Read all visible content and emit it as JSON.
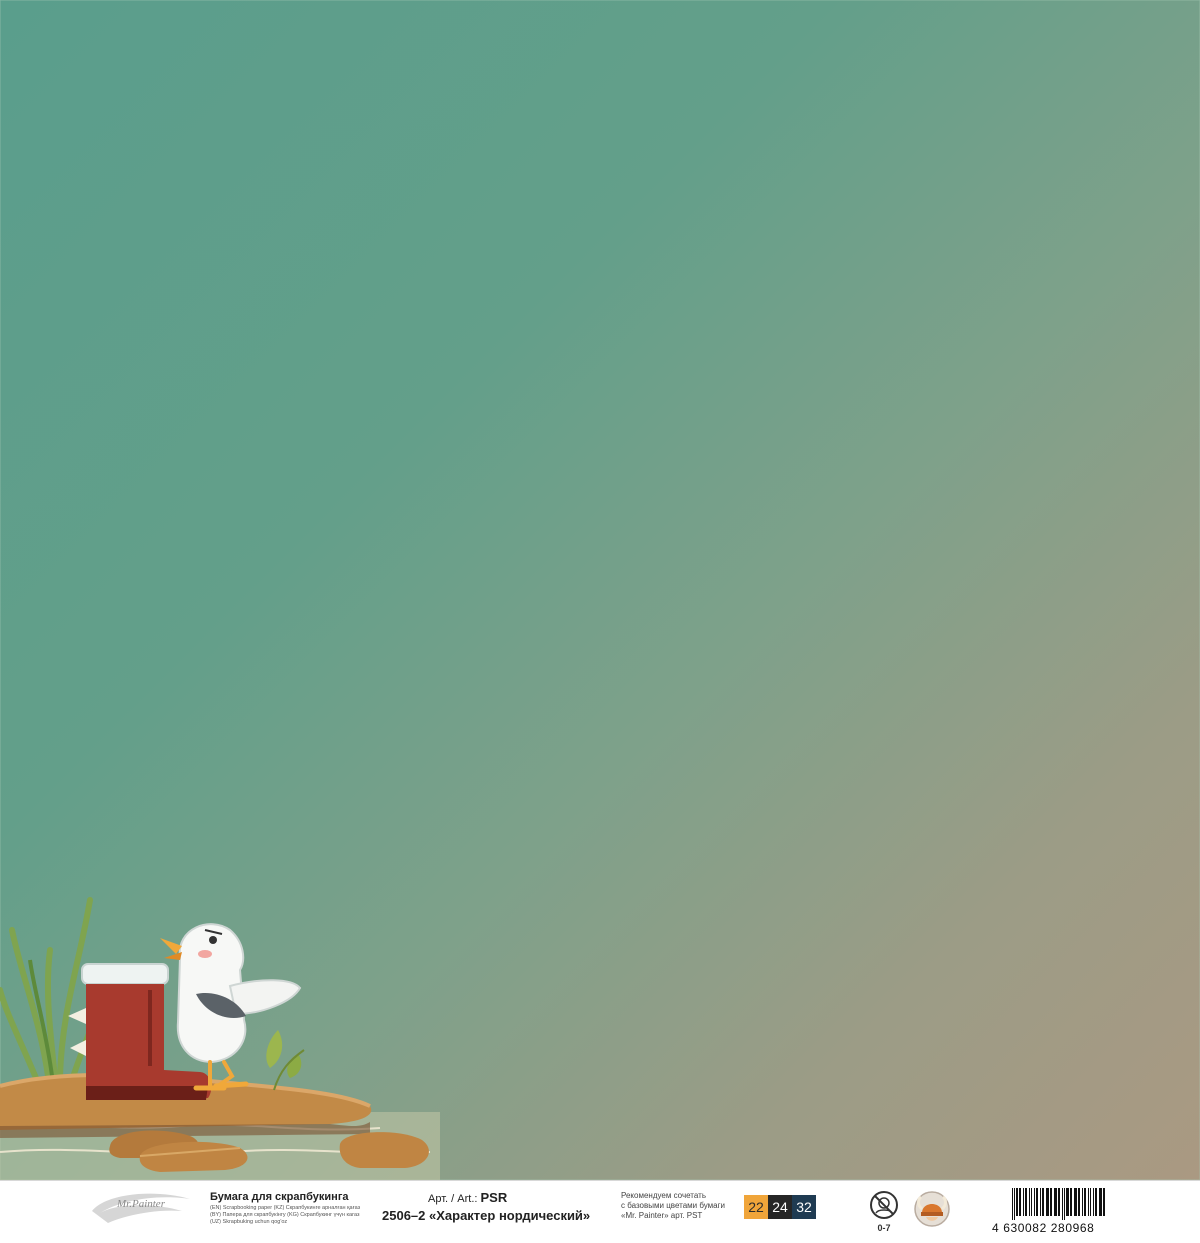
{
  "footer": {
    "brand": "Mr.Painter",
    "product_title": "Бумага для скрапбукинга",
    "languages": [
      "(EN) Scrapbooking paper (KZ) Скрапбукинге арналған қағаз",
      "(BY) Папера для скрапбукінгу (KG) Скрапбукинг үчүн кагаз",
      "(UZ) Skrapbuking uchun qog'oz"
    ],
    "article_label": "Арт. / Art.:",
    "article_code": "PSR",
    "article_name": "2506–2 «Характер нордический»",
    "recommend": [
      "Рекомендуем сочетать",
      "с базовыми цветами бумаги",
      "«Mr. Painter» арт. PST"
    ],
    "swatches": [
      {
        "label": "22",
        "color": "#f0a53a"
      },
      {
        "label": "24",
        "color": "#262626"
      },
      {
        "label": "32",
        "color": "#1f3b52"
      }
    ],
    "age_label": "0-7",
    "barcode_digits": "4 630082 280968"
  },
  "icons": {
    "age": "no-small-children-icon",
    "mascot": "viking-helmet-icon",
    "brand": "brand-swoosh-icon"
  },
  "colors": {
    "paper_teal": "#5a9e8c",
    "paper_taupe": "#aa9982",
    "wave_line": "#a9cbb8"
  }
}
